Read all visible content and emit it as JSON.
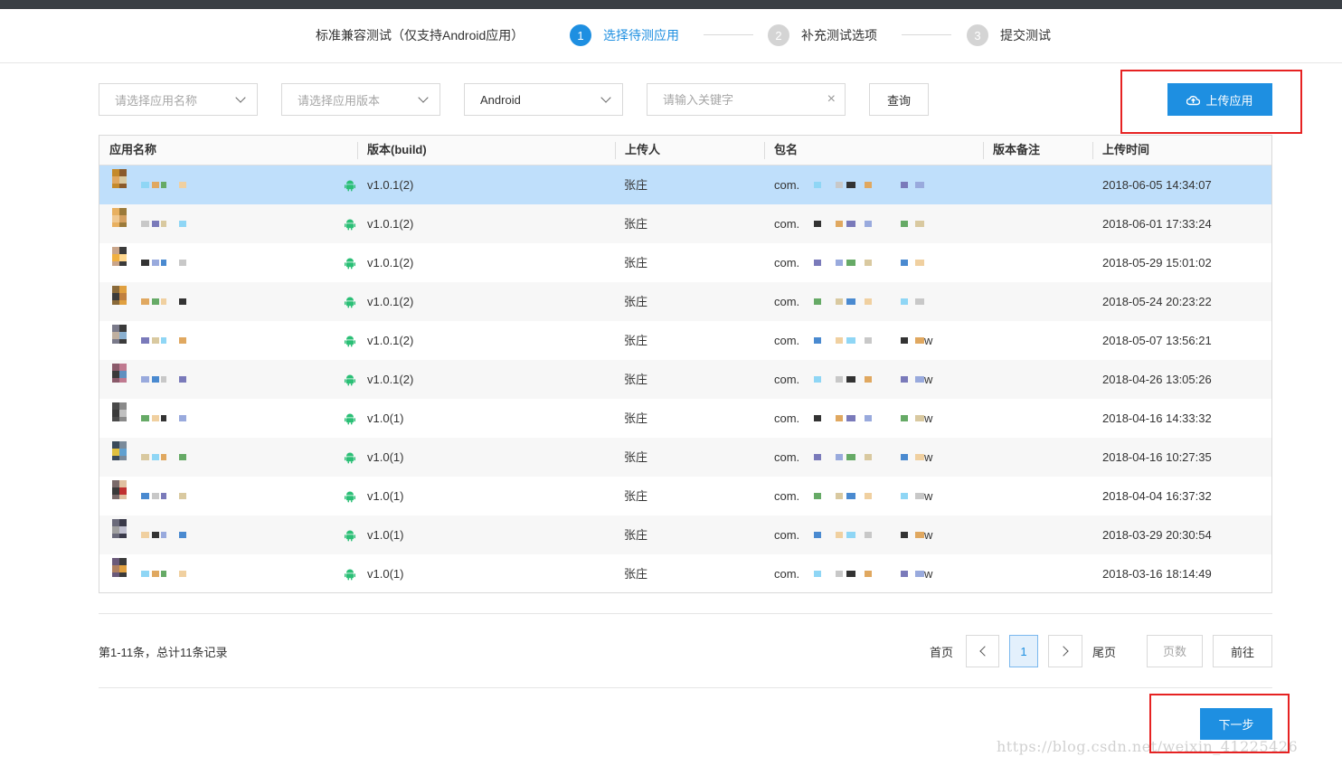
{
  "steps_bar": {
    "title": "标准兼容测试（仅支持Android应用）",
    "steps": [
      {
        "num": "1",
        "label": "选择待测应用"
      },
      {
        "num": "2",
        "label": "补充测试选项"
      },
      {
        "num": "3",
        "label": "提交测试"
      }
    ]
  },
  "filters": {
    "app_name_placeholder": "请选择应用名称",
    "app_version_placeholder": "请选择应用版本",
    "platform_value": "Android",
    "keyword_placeholder": "请输入关键字",
    "clear_icon": "×",
    "query_label": "查询"
  },
  "upload": {
    "label": "上传应用",
    "icon": "cloud-upload-icon"
  },
  "table": {
    "headers": [
      "应用名称",
      "版本(build)",
      "上传人",
      "包名",
      "版本备注",
      "上传时间"
    ],
    "rows": [
      {
        "version": "v1.0.1(2)",
        "uploader": "张庄",
        "package_prefix": "com.",
        "package_suffix": "",
        "note": "",
        "time": "2018-06-05 14:34:07"
      },
      {
        "version": "v1.0.1(2)",
        "uploader": "张庄",
        "package_prefix": "com.",
        "package_suffix": "",
        "note": "",
        "time": "2018-06-01 17:33:24"
      },
      {
        "version": "v1.0.1(2)",
        "uploader": "张庄",
        "package_prefix": "com.",
        "package_suffix": "",
        "note": "",
        "time": "2018-05-29 15:01:02"
      },
      {
        "version": "v1.0.1(2)",
        "uploader": "张庄",
        "package_prefix": "com.",
        "package_suffix": "",
        "note": "",
        "time": "2018-05-24 20:23:22"
      },
      {
        "version": "v1.0.1(2)",
        "uploader": "张庄",
        "package_prefix": "com.",
        "package_suffix": "w",
        "note": "",
        "time": "2018-05-07 13:56:21"
      },
      {
        "version": "v1.0.1(2)",
        "uploader": "张庄",
        "package_prefix": "com.",
        "package_suffix": "w",
        "note": "",
        "time": "2018-04-26 13:05:26"
      },
      {
        "version": "v1.0(1)",
        "uploader": "张庄",
        "package_prefix": "com.",
        "package_suffix": "w",
        "note": "",
        "time": "2018-04-16 14:33:32"
      },
      {
        "version": "v1.0(1)",
        "uploader": "张庄",
        "package_prefix": "com.",
        "package_suffix": "w",
        "note": "",
        "time": "2018-04-16 10:27:35"
      },
      {
        "version": "v1.0(1)",
        "uploader": "张庄",
        "package_prefix": "com.",
        "package_suffix": "w",
        "note": "",
        "time": "2018-04-04 16:37:32"
      },
      {
        "version": "v1.0(1)",
        "uploader": "张庄",
        "package_prefix": "com.",
        "package_suffix": "w",
        "note": "",
        "time": "2018-03-29 20:30:54"
      },
      {
        "version": "v1.0(1)",
        "uploader": "张庄",
        "package_prefix": "com.",
        "package_suffix": "w",
        "note": "",
        "time": "2018-03-16 18:14:49"
      }
    ]
  },
  "pagination": {
    "summary": "第1-11条，总计11条记录",
    "first_label": "首页",
    "current_page": "1",
    "last_label": "尾页",
    "page_input_placeholder": "页数",
    "go_label": "前往"
  },
  "next_button": {
    "label": "下一步"
  },
  "watermark": "https://blog.csdn.net/weixin_41225426",
  "colors": {
    "accent": "#1e8fe1",
    "selected_row": "#bfdffb",
    "highlight_box": "#e62222",
    "android_green": "#2bbf76"
  }
}
